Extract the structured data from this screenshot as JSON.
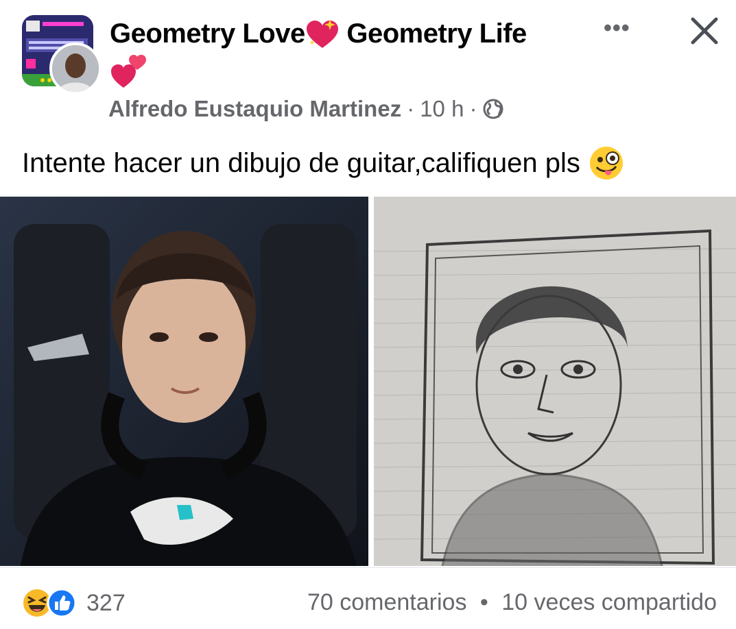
{
  "post": {
    "group_name_part1": "Geometry Love",
    "group_name_part2": " Geometry Life",
    "author": "Alfredo Eustaquio Martinez",
    "time": "10 h",
    "separator": "·",
    "privacy_icon": "globe-icon",
    "text": "Intente hacer un dibujo de guitar,califiquen pls",
    "text_emoji": "zany-face-emoji"
  },
  "header_actions": {
    "more_icon": "more-icon",
    "more_label": "•••",
    "close_icon": "close-icon"
  },
  "media": {
    "photo_left": "photo-of-young-man-with-headphones",
    "photo_right": "pencil-drawing-portrait"
  },
  "footer": {
    "reaction_icons": [
      "haha-reaction-icon",
      "like-reaction-icon"
    ],
    "reaction_count": "327",
    "comments": "70 comentarios",
    "dot": "•",
    "shares": "10 veces compartido"
  },
  "colors": {
    "secondary_text": "#65676b",
    "like_blue": "#1877f2",
    "haha_yellow": "#f7b928"
  }
}
